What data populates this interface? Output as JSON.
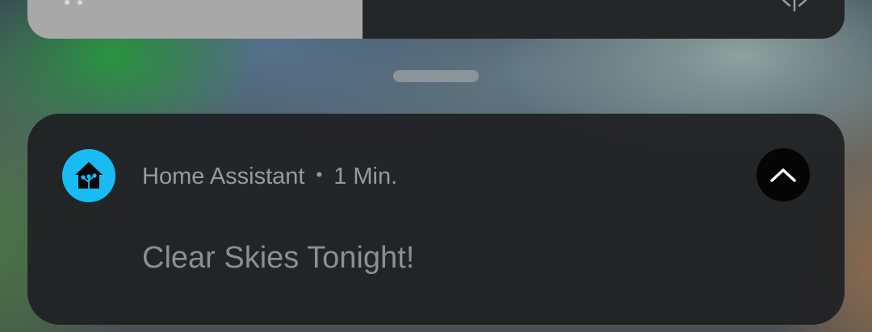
{
  "quick_settings": {
    "brightness_level": 0.41,
    "brightness_icon": "sun-icon",
    "fill_color": "#a8a8a8",
    "track_color": "#252628"
  },
  "notification": {
    "app_name": "Home Assistant",
    "separator": "•",
    "time": "1 Min.",
    "message": "Clear Skies Tonight!",
    "app_icon": "home-assistant-icon",
    "app_icon_color": "#18bcf2",
    "collapse_icon": "chevron-up-icon"
  }
}
